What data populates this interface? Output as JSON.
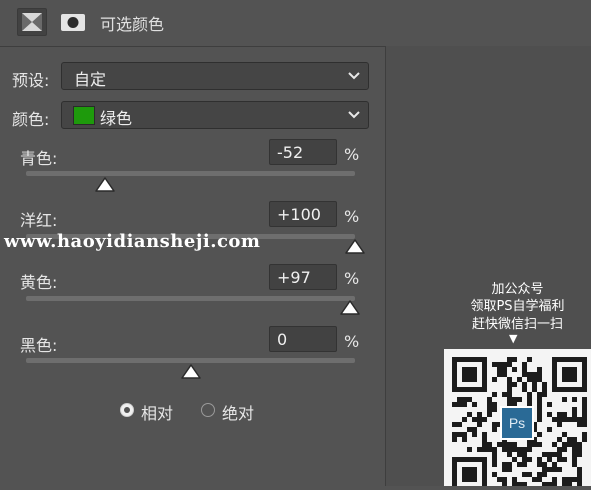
{
  "header": {
    "title": "可选颜色",
    "icons": [
      "adjustment-layer-icon",
      "mask-icon"
    ]
  },
  "preset": {
    "label": "预设:",
    "value": "自定"
  },
  "color": {
    "label": "颜色:",
    "value": "绿色",
    "swatch_color": "#1e9a0c"
  },
  "sliders": [
    {
      "label": "青色:",
      "value": "-52",
      "unit": "%",
      "level": -52
    },
    {
      "label": "洋红:",
      "value": "+100",
      "unit": "%",
      "level": 100
    },
    {
      "label": "黄色:",
      "value": "+97",
      "unit": "%",
      "level": 97
    },
    {
      "label": "黑色:",
      "value": "0",
      "unit": "%",
      "level": 0
    }
  ],
  "method": {
    "relative_label": "相对",
    "absolute_label": "绝对",
    "selected": "relative"
  },
  "watermark": {
    "text": "www.haoyidiansheji.com"
  },
  "promo": {
    "line1": "加公众号",
    "line2": "领取PS自学福利",
    "line3": "赶快微信扫一扫",
    "arrow": "▼",
    "badge": "Ps"
  }
}
